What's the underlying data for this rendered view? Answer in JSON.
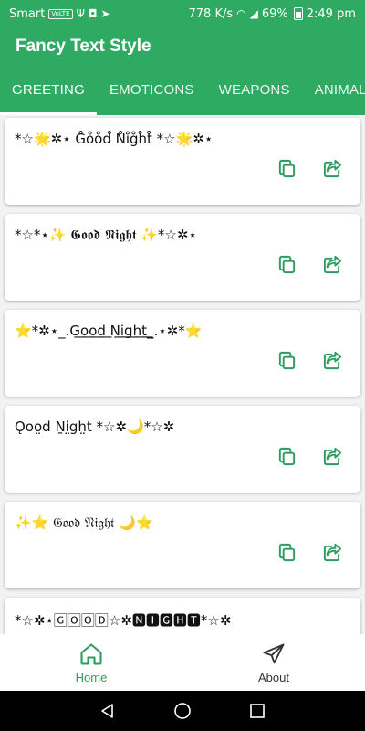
{
  "status_bar": {
    "carrier": "Smart",
    "volte_badge": "VoLTE",
    "network_speed": "778 K/s",
    "battery": "69%",
    "time": "2:49 pm",
    "icons": [
      "volte-icon",
      "usb-icon",
      "shield-app-icon",
      "telegram-icon",
      "wifi-icon",
      "signal-icon",
      "battery-icon"
    ]
  },
  "app_bar": {
    "title": "Fancy Text Style"
  },
  "tabs": [
    {
      "label": "GREETING",
      "active": true
    },
    {
      "label": "EMOTICONS",
      "active": false
    },
    {
      "label": "WEAPONS",
      "active": false
    },
    {
      "label": "ANIMAL",
      "active": false
    }
  ],
  "cards": [
    {
      "text": "*☆🌟✲⋆ G̊o̊o̊d̊ N̊i̊g̊h̊t̊ *☆🌟✲⋆"
    },
    {
      "text": "*☆*⋆✨ 𝕲𝖔𝖔𝖉 𝕹𝖎𝖌𝖍𝖙 ✨*☆✲⋆"
    },
    {
      "text": "⭐*✲⋆_.G͟o͟o͟d͟ N͟i͟g͟h͟t͟_.⋆✲*⭐"
    },
    {
      "text": "Ǫoo̤d Ṉi̤g̤h̤t *☆✲🌙*☆✲"
    },
    {
      "text": "✨⭐ 𝔊𝔬𝔬𝔡 𝔑𝔦𝔤𝔥𝔱 🌙⭐"
    },
    {
      "text": "*☆✲⋆🄶🄾🄾🄳☆✲🅽🅸🅶🅷🆃*☆✲"
    }
  ],
  "card_actions": {
    "copy_icon": "copy-icon",
    "share_icon": "share-icon"
  },
  "bottom_nav": [
    {
      "label": "Home",
      "icon": "home-icon",
      "active": true
    },
    {
      "label": "About",
      "icon": "send-icon",
      "active": false
    }
  ],
  "system_nav": {
    "icons": [
      "back-icon",
      "home-circle-icon",
      "recents-icon"
    ]
  },
  "colors": {
    "primary": "#2eaa63",
    "accent": "#2e9b5e",
    "surface": "#ffffff",
    "background": "#f2f2f2"
  }
}
